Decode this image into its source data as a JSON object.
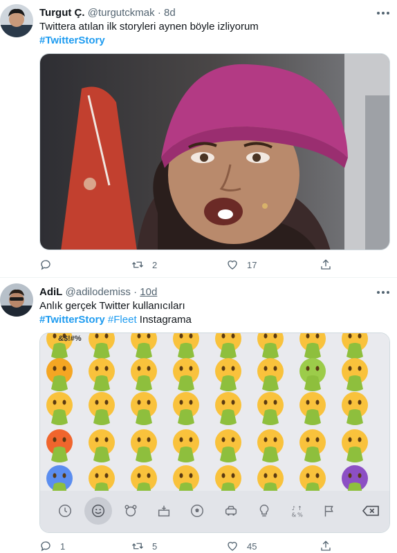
{
  "tweets": [
    {
      "name": "Turgut Ç.",
      "handle": "@turgutckmak",
      "dot": "·",
      "time": "8d",
      "text": "Twittera atılan ilk storyleri aynen böyle izliyorum",
      "hashtag": "#TwitterStory",
      "replies": "",
      "retweets": "2",
      "likes": "17"
    },
    {
      "name": "AdiL",
      "handle": "@adilodemiss",
      "dot": "·",
      "time": "10d",
      "text": "Anlık gerçek Twitter kullanıcıları",
      "hashtag1": "#TwitterStory",
      "hashtag2": "#Fleet",
      "text_after": "Instagrama",
      "replies": "1",
      "retweets": "5",
      "likes": "45",
      "keyboard_top_text": "&$!#%"
    }
  ],
  "colors": {
    "link": "#1d9bf0",
    "muted": "#536471",
    "border": "#eff3f4",
    "beanie": "#b33a84",
    "emoji_yellow": "#f9c23c",
    "emoji_green": "#8ebf3d"
  },
  "icons": [
    "more-icon",
    "reply-icon",
    "retweet-icon",
    "like-icon",
    "share-icon",
    "clock-icon",
    "smiley-icon",
    "bear-icon",
    "cake-icon",
    "ball-icon",
    "car-icon",
    "bulb-icon",
    "symbols-icon",
    "flag-icon",
    "backspace-icon"
  ]
}
